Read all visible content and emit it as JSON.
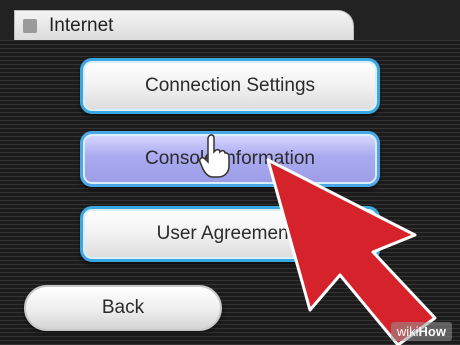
{
  "window": {
    "title": "Internet"
  },
  "menu": {
    "items": [
      {
        "label": "Connection Settings",
        "selected": false
      },
      {
        "label": "Console Information",
        "selected": true
      },
      {
        "label": "User Agreements",
        "selected": false
      }
    ]
  },
  "footer": {
    "back_label": "Back"
  },
  "overlay": {
    "arrow_color": "#d6222a",
    "watermark_prefix": "wiki",
    "watermark_suffix": "How"
  },
  "colors": {
    "button_border": "#3aa7e0",
    "selected_fill": "#aaaaf2",
    "background": "#2a2a2a"
  }
}
